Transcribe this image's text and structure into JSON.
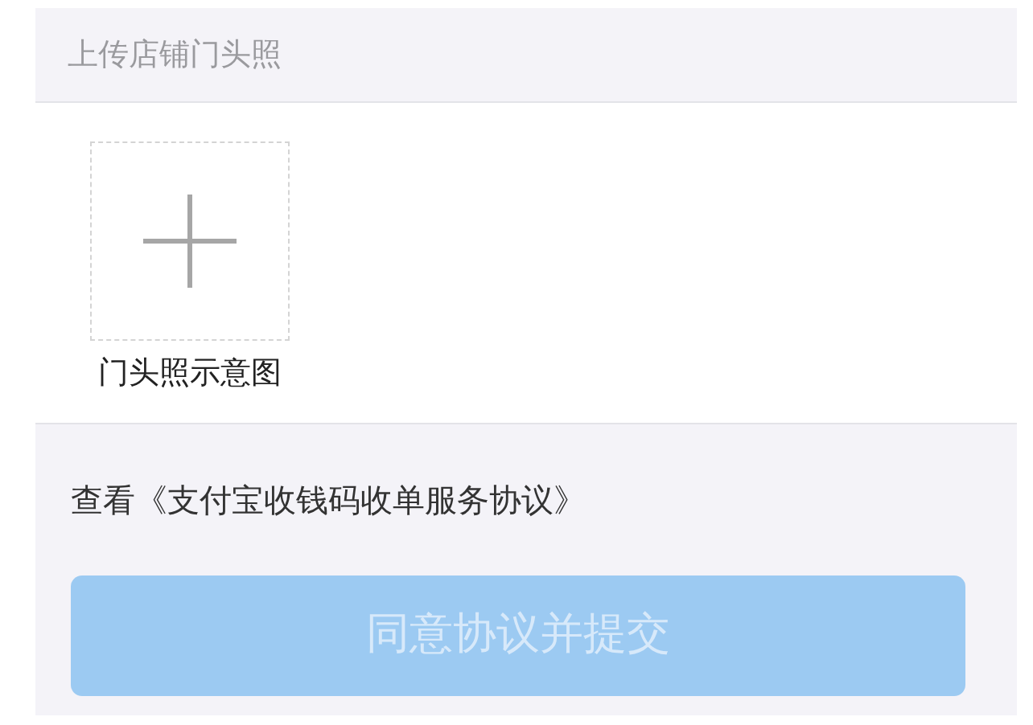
{
  "section_header": "上传店铺门头照",
  "upload": {
    "caption": "门头照示意图"
  },
  "agreement_link": "查看《支付宝收钱码收单服务协议》",
  "submit_button": {
    "label": "同意协议并提交",
    "disabled": true
  }
}
